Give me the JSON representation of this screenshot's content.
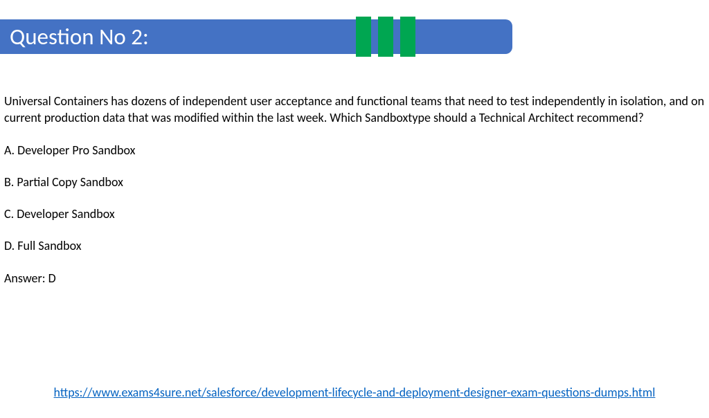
{
  "title": "Question No 2:",
  "question": "Universal Containers has dozens of independent user acceptance and functional teams that need to test independently in isolation, and on current production data that was modified within the last week. Which Sandboxtype should a Technical Architect recommend?",
  "options": [
    "A. Developer Pro Sandbox",
    "B. Partial Copy Sandbox",
    "C. Developer Sandbox",
    "D. Full Sandbox"
  ],
  "answer": "Answer: D",
  "link": "https://www.exams4sure.net/salesforce/development-lifecycle-and-deployment-designer-exam-questions-dumps.html"
}
